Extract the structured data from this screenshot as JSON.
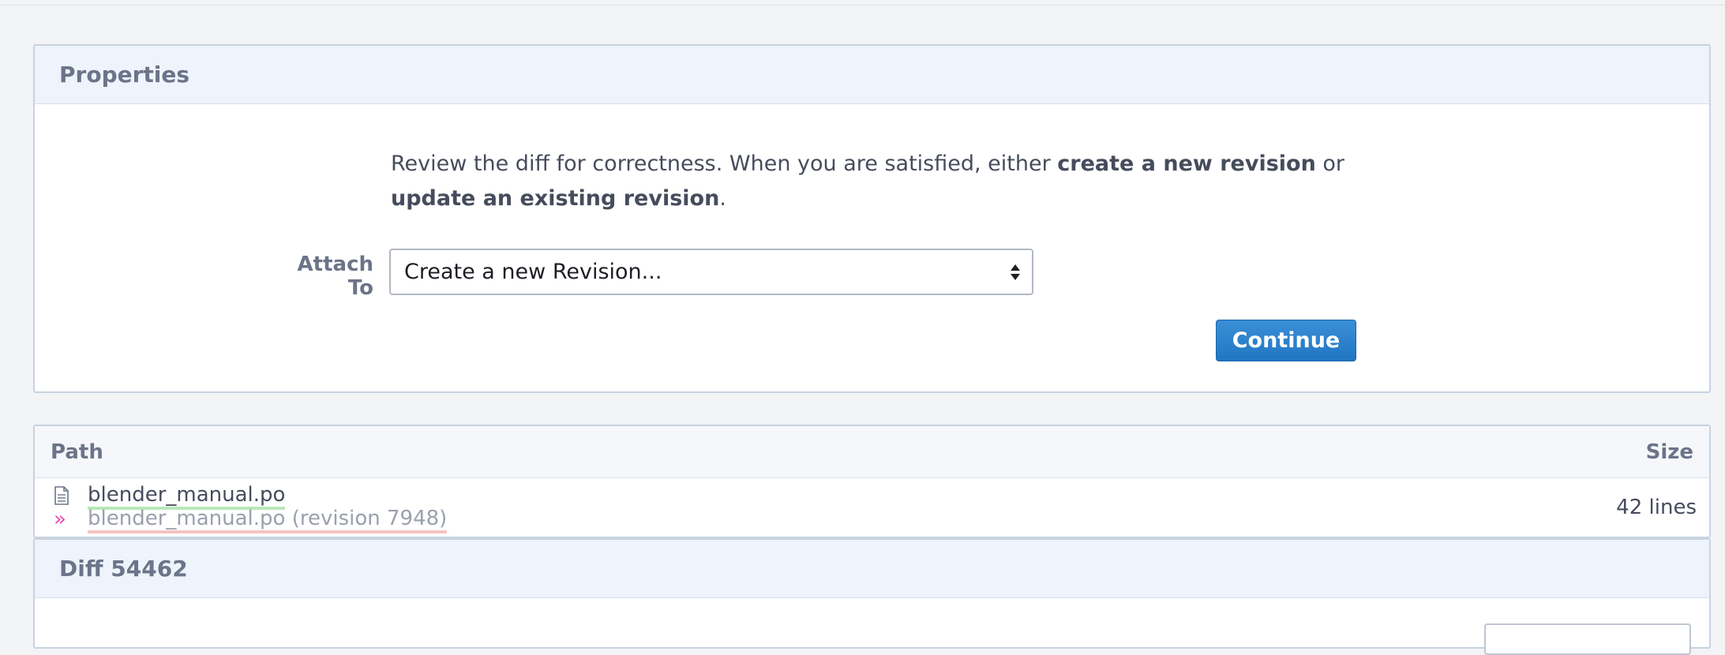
{
  "properties": {
    "title": "Properties",
    "desc_part1": "Review the diff for correctness. When you are satisfied, either ",
    "desc_bold1": "create a new revision",
    "desc_part2": " or ",
    "desc_bold2": "update an existing revision",
    "desc_part3": ".",
    "attach_label": "Attach To",
    "attach_value": "Create a new Revision...",
    "continue_label": "Continue"
  },
  "files": {
    "col_path": "Path",
    "col_size": "Size",
    "file_name": "blender_manual.po",
    "old_name": "blender_manual.po (revision 7948)",
    "size": "42 lines",
    "icons": {
      "file": "file-icon",
      "old": "double-chevron-icon"
    }
  },
  "diff": {
    "title": "Diff 54462"
  },
  "colors": {
    "accent": "#2176c3",
    "header_bg": "#eef3fc",
    "added": "#b8e8b8",
    "removed": "#f4c3c3"
  }
}
